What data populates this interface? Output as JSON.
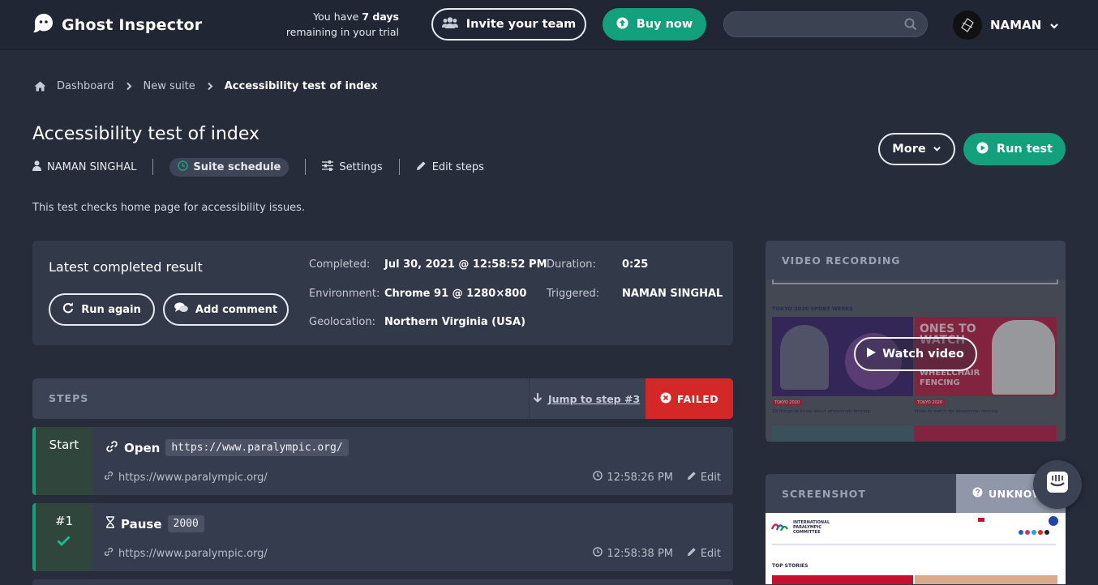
{
  "header": {
    "brand": "Ghost Inspector",
    "trial_prefix": "You have ",
    "trial_days": "7 days",
    "trial_suffix": "remaining in your trial",
    "invite_label": "Invite your team",
    "buy_label": "Buy now",
    "search_placeholder": "",
    "user_name": "NAMAN",
    "icons": [
      "ghost-logo-icon",
      "users-icon",
      "upload-circle-icon",
      "search-icon",
      "chevron-down-icon"
    ]
  },
  "breadcrumb": {
    "items": [
      "Dashboard",
      "New suite",
      "Accessibility test of index"
    ]
  },
  "test": {
    "title": "Accessibility test of index",
    "owner": "NAMAN SINGHAL",
    "schedule_label": "Suite schedule",
    "settings_label": "Settings",
    "edit_steps_label": "Edit steps",
    "description": "This test checks home page for accessibility issues.",
    "more_label": "More",
    "run_label": "Run test"
  },
  "result": {
    "title": "Latest completed result",
    "run_again_label": "Run again",
    "add_comment_label": "Add comment",
    "completed_label": "Completed:",
    "completed_value": "Jul 30, 2021 @ 12:58:52 PM",
    "environment_label": "Environment:",
    "environment_value": "Chrome 91 @ 1280×800",
    "geolocation_label": "Geolocation:",
    "geolocation_value": "Northern Virginia (USA)",
    "duration_label": "Duration:",
    "duration_value": "0:25",
    "triggered_label": "Triggered:",
    "triggered_value": "NAMAN SINGHAL"
  },
  "steps": {
    "header_label": "STEPS",
    "jump_label": "Jump to step #3",
    "status_label": "FAILED",
    "items": [
      {
        "number": "Start",
        "action": "Open",
        "value": "https://www.paralympic.org/",
        "url": "https://www.paralympic.org/",
        "time": "12:58:26 PM",
        "edit_label": "Edit",
        "passed": false
      },
      {
        "number": "#1",
        "action": "Pause",
        "value": "2000",
        "url": "https://www.paralympic.org/",
        "time": "12:58:38 PM",
        "edit_label": "Edit",
        "passed": true
      }
    ]
  },
  "video": {
    "header_label": "VIDEO RECORDING",
    "watch_label": "Watch video",
    "thumb_heading": "TOKYO 2020 SPORT WEEKS",
    "thumb_overlay": "ONES TO WATCH",
    "thumb_overlay2": "WHEELCHAIR FENCING",
    "thumb_caption1": "10 things to know about wheelchair fencing",
    "thumb_caption2": "Ones to watch for wheelchair fencing",
    "thumb_tag": "TOKYO 2020"
  },
  "screenshot": {
    "header_label": "SCREENSHOT",
    "status_label": "UNKNOWN",
    "thumb_org": "INTERNATIONAL PARALYMPIC COMMITTEE",
    "thumb_section": "TOP STORIES"
  },
  "colors": {
    "background": "#262c3a",
    "topbar": "#202633",
    "accent_green": "#12a17c",
    "failed_red": "#d42828",
    "card": "#323949"
  }
}
